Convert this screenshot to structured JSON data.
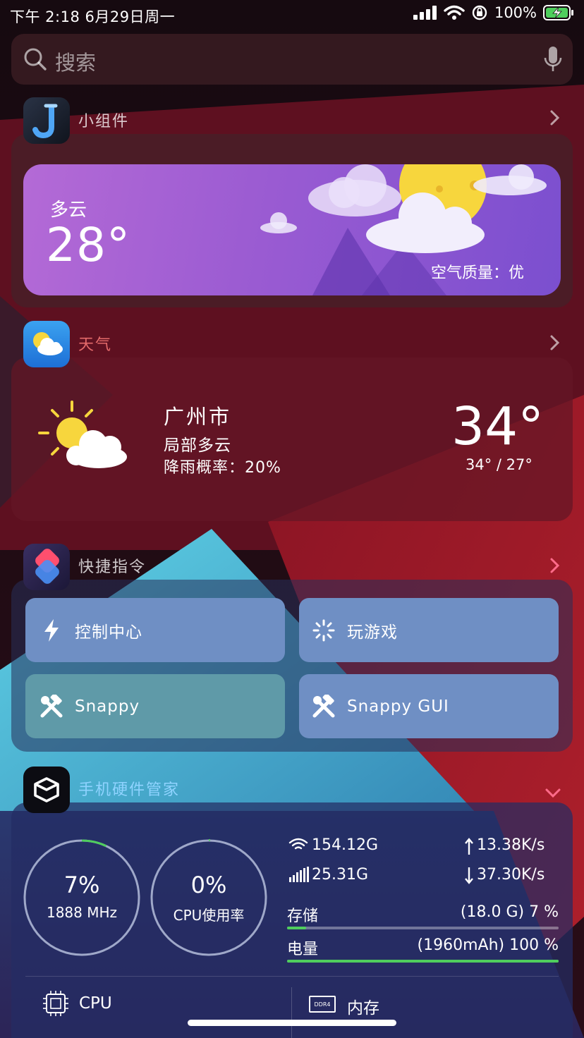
{
  "status_bar": {
    "time_date": "下午 2:18    6月29日周一",
    "battery": "100%"
  },
  "search": {
    "placeholder": "搜索"
  },
  "widgets_section": {
    "title": "小组件",
    "weather_card": {
      "condition": "多云",
      "temperature": "28°",
      "air_quality": "空气质量：优"
    }
  },
  "weather_section": {
    "title": "天气",
    "city": "广州市",
    "condition": "局部多云",
    "rain_chance": "降雨概率：20%",
    "temperature": "34°",
    "range": "34° / 27°"
  },
  "shortcuts_section": {
    "title": "快捷指令",
    "items": [
      {
        "label": "控制中心",
        "icon": "bolt-icon",
        "color": "#6f8fc4"
      },
      {
        "label": "玩游戏",
        "icon": "spinner-icon",
        "color": "#6f8fc4"
      },
      {
        "label": "Snappy",
        "icon": "hammer-wrench-icon",
        "color": "#5f9aa8"
      },
      {
        "label": "Snappy GUI",
        "icon": "hammer-wrench-icon",
        "color": "#6f8fc4"
      }
    ]
  },
  "hardware_section": {
    "title": "手机硬件管家",
    "cpu_freq": {
      "percent_label": "7%",
      "sub": "1888 MHz",
      "fraction": 0.07
    },
    "cpu_usage": {
      "percent_label": "0%",
      "sub": "CPU使用率",
      "fraction": 0.0
    },
    "wifi_total": "154.12G",
    "cell_total": "25.31G",
    "upload_speed": "13.38K/s",
    "download_speed": "37.30K/s",
    "storage": {
      "label": "存储",
      "value": "(18.0 G) 7 %",
      "fraction": 0.07
    },
    "battery": {
      "label": "电量",
      "value": "(1960mAh) 100 %",
      "fraction": 1.0
    },
    "tabs": [
      "CPU",
      "内存"
    ],
    "ddr_label": "DDR4"
  },
  "colors": {
    "accent_green": "#4fce5d",
    "section_title_blue": "#8fd3ff"
  }
}
